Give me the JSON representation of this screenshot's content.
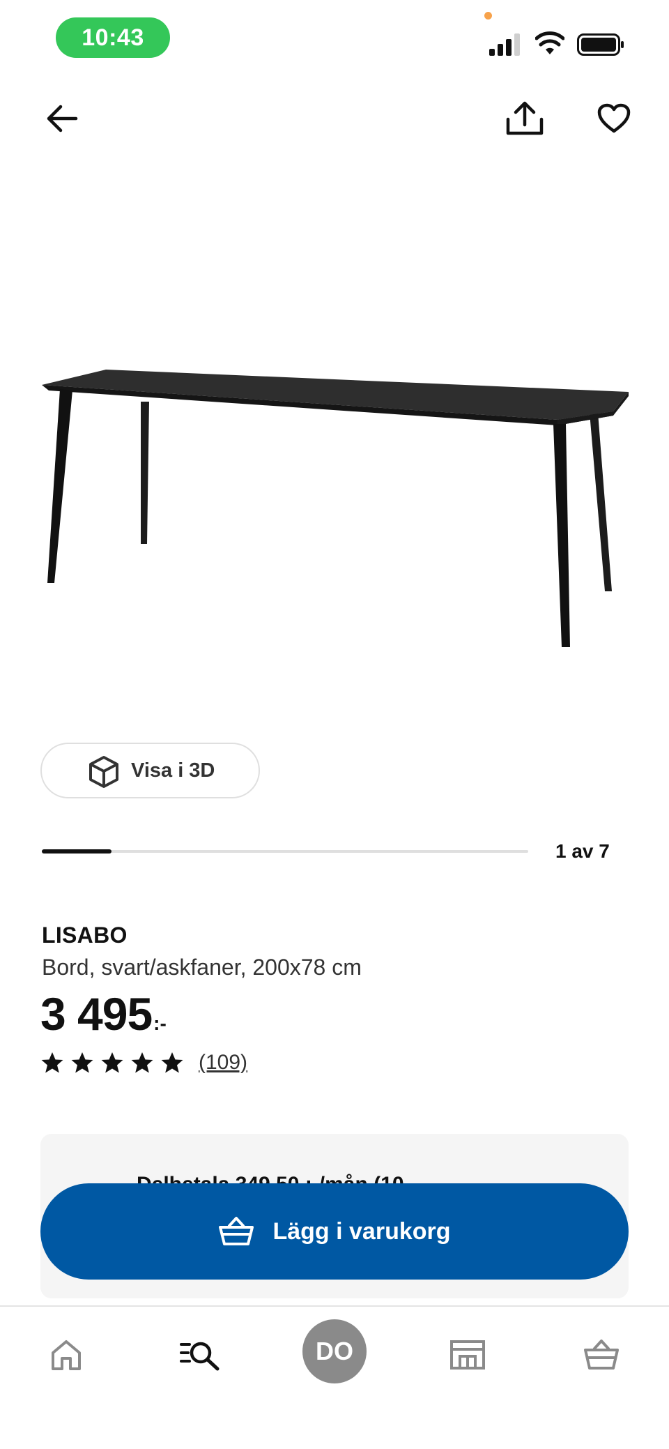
{
  "status_bar": {
    "time": "10:43",
    "icons": [
      "cellular-signal-icon",
      "wifi-icon",
      "battery-icon"
    ]
  },
  "nav": {
    "back_icon": "arrow-left-icon",
    "share_icon": "share-icon",
    "favorite_icon": "heart-icon"
  },
  "gallery": {
    "view_3d_label": "Visa i 3D",
    "current": 1,
    "total": 7,
    "pager_text": "1 av 7"
  },
  "product": {
    "name": "LISABO",
    "description": "Bord, svart/askfaner, 200x78 cm",
    "price": "3 495",
    "price_suffix": ":-",
    "rating": 5,
    "review_count": "(109)"
  },
  "installment": {
    "text": "Delbetala 349,50 :-/mån (10"
  },
  "cart_button": {
    "label": "Lägg i varukorg"
  },
  "tab_bar": {
    "avatar_initials": "DO",
    "tabs": [
      "home-icon",
      "search-icon",
      "profile-avatar",
      "store-icon",
      "cart-icon"
    ]
  },
  "colors": {
    "primary_blue": "#0058a3",
    "status_green": "#34c759",
    "avatar_gray": "#8a8a8a",
    "card_bg": "#f5f5f5"
  }
}
